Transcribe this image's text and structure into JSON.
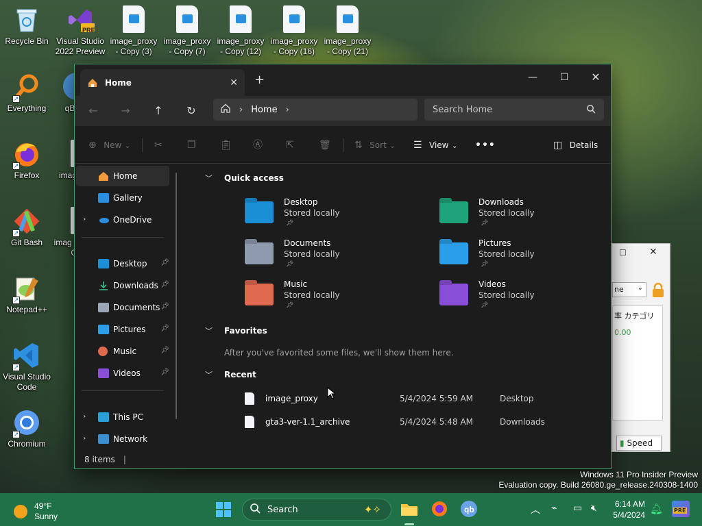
{
  "desktop": {
    "icons": [
      {
        "label": "Recycle Bin"
      },
      {
        "label": "Visual Studio 2022 Preview",
        "badge": "PRE"
      },
      {
        "label": "image_proxy - Copy (3)"
      },
      {
        "label": "image_proxy - Copy (7)"
      },
      {
        "label": "image_proxy - Copy (12)"
      },
      {
        "label": "image_proxy - Copy (16)"
      },
      {
        "label": "image_proxy - Copy (21)"
      },
      {
        "label": "Everything"
      },
      {
        "label": "qBi"
      },
      {
        "label": "Firefox"
      },
      {
        "label": "imag"
      },
      {
        "label": "Git Bash"
      },
      {
        "label": "imag - C"
      },
      {
        "label": "Notepad++"
      },
      {
        "label": "Visual Studio Code"
      },
      {
        "label": "Chromium"
      }
    ]
  },
  "explorer": {
    "tab_title": "Home",
    "address": {
      "crumb": "Home"
    },
    "search": {
      "placeholder": "Search Home"
    },
    "toolbar": {
      "new_label": "New",
      "sort_label": "Sort",
      "view_label": "View",
      "details_label": "Details"
    },
    "sidebar": {
      "items": [
        {
          "label": "Home"
        },
        {
          "label": "Gallery"
        },
        {
          "label": "OneDrive"
        },
        {
          "label": "Desktop"
        },
        {
          "label": "Downloads"
        },
        {
          "label": "Documents"
        },
        {
          "label": "Pictures"
        },
        {
          "label": "Music"
        },
        {
          "label": "Videos"
        },
        {
          "label": "This PC"
        },
        {
          "label": "Network"
        }
      ]
    },
    "quick_access": {
      "title": "Quick access",
      "folders": [
        {
          "name": "Desktop",
          "sub": "Stored locally",
          "color": "#1a8fd6"
        },
        {
          "name": "Downloads",
          "sub": "Stored locally",
          "color": "#1fa37a"
        },
        {
          "name": "Documents",
          "sub": "Stored locally",
          "color": "#8e9aae"
        },
        {
          "name": "Pictures",
          "sub": "Stored locally",
          "color": "#2a9ee8"
        },
        {
          "name": "Music",
          "sub": "Stored locally",
          "color": "#e06a4f"
        },
        {
          "name": "Videos",
          "sub": "Stored locally",
          "color": "#8a4fd8"
        }
      ]
    },
    "favorites": {
      "title": "Favorites",
      "empty_text": "After you've favorited some files, we'll show them here."
    },
    "recent": {
      "title": "Recent",
      "rows": [
        {
          "name": "image_proxy",
          "date": "5/4/2024 5:59 AM",
          "location": "Desktop"
        },
        {
          "name": "gta3-ver-1.1_archive",
          "date": "5/4/2024 5:48 AM",
          "location": "Downloads"
        }
      ]
    },
    "status": {
      "items": "8 items"
    }
  },
  "bg_window": {
    "dropdown_fragment": "ne",
    "header_fragment": "率 カテゴリ",
    "value_fragment": "0.00",
    "button_label": "Speed"
  },
  "watermark": {
    "line1": "Windows 11 Pro Insider Preview",
    "line2": "Evaluation copy. Build 26080.ge_release.240308-1400"
  },
  "taskbar": {
    "weather_temp": "49°F",
    "weather_desc": "Sunny",
    "search_label": "Search",
    "time": "6:14 AM",
    "date": "5/4/2024",
    "tray_badge": "PRE"
  },
  "colors": {
    "accent": "#3ea06a",
    "taskbar": "#207148",
    "explorer_bg": "#1c1c1c"
  }
}
